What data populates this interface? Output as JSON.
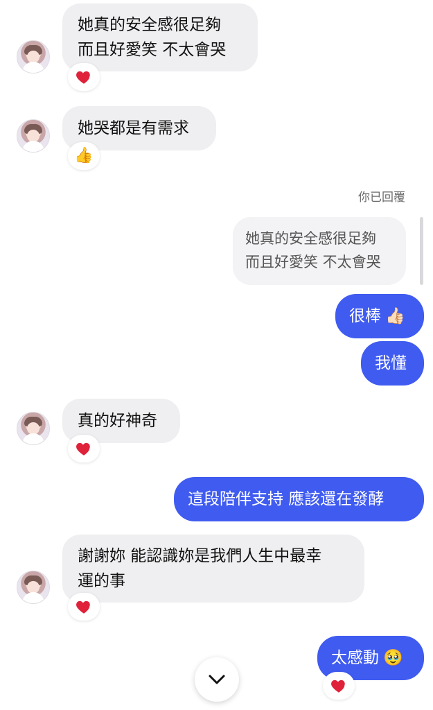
{
  "messages": {
    "m1": {
      "line1": "她真的安全感很足夠",
      "line2": "而且好愛笑 不太會哭",
      "reaction": "heart-icon"
    },
    "m2": {
      "text": "她哭都是有需求",
      "reaction": "thumbs-up-icon"
    },
    "reply": {
      "tag": "你已回覆",
      "quote_line1": "她真的安全感很足夠",
      "quote_line2": "而且好愛笑 不太會哭"
    },
    "m3": {
      "text": "很棒"
    },
    "m4": {
      "text": "我懂"
    },
    "m5": {
      "text": "真的好神奇",
      "reaction": "heart-icon"
    },
    "m6": {
      "text": "這段陪伴支持 應該還在發酵"
    },
    "m7": {
      "line1": "謝謝妳 能認識妳是我們人生中最幸",
      "line2": "運的事",
      "reaction": "heart-icon"
    },
    "m8": {
      "text": "太感動",
      "reaction": "heart-icon"
    }
  },
  "colors": {
    "incoming_bubble": "#efeff1",
    "outgoing_bubble": "#3f5bf0",
    "heart": "#e0213a"
  },
  "icons": {
    "scroll_down": "chevron-down-icon",
    "thumbs_up_emoji": "👍",
    "thumbs_up_light_emoji": "👍🏻",
    "pleading_face_emoji": "🥹"
  }
}
